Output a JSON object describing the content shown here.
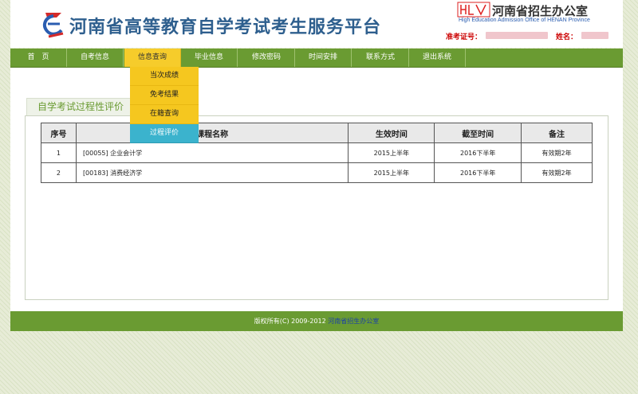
{
  "header": {
    "site_title": "河南省高等教育自学考试考生服务平台",
    "office_name": "河南省招生办公室",
    "office_name_en": "High Education Admission Office of HENAN Province",
    "candidate_no_label": "准考证号：",
    "name_label": "姓名："
  },
  "nav": {
    "items": [
      {
        "label": "首　页"
      },
      {
        "label": "自考信息"
      },
      {
        "label": "信息查询"
      },
      {
        "label": "毕业信息"
      },
      {
        "label": "修改密码"
      },
      {
        "label": "时间安排"
      },
      {
        "label": "联系方式"
      },
      {
        "label": "退出系统"
      }
    ],
    "active_index": 2
  },
  "dropdown": {
    "items": [
      {
        "label": "当次成绩"
      },
      {
        "label": "免考结果"
      },
      {
        "label": "在籍查询"
      },
      {
        "label": "过程评价"
      }
    ],
    "active_index": 3
  },
  "section": {
    "title": "自学考试过程性评价"
  },
  "table": {
    "headers": [
      "序号",
      "课程名称",
      "生效时间",
      "截至时间",
      "备注"
    ],
    "rows": [
      {
        "no": "1",
        "course": "[00055] 企业会计学",
        "start": "2015上半年",
        "end": "2016下半年",
        "note": "有效期2年"
      },
      {
        "no": "2",
        "course": "[00183] 消费经济学",
        "start": "2015上半年",
        "end": "2016下半年",
        "note": "有效期2年"
      }
    ]
  },
  "footer": {
    "copyright": "版权所有(C) 2009-2012",
    "link_text": "河南省招生办公室"
  },
  "colors": {
    "nav_green": "#6a9b32",
    "nav_active": "#f6cc2b",
    "dropdown_active": "#3bb3cd",
    "title_blue": "#2e5f8e"
  }
}
